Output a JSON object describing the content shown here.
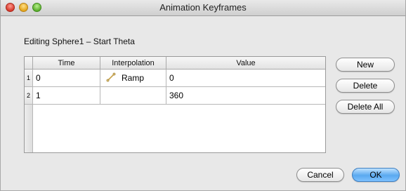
{
  "window": {
    "title": "Animation Keyframes"
  },
  "editing_label": "Editing Sphere1 – Start Theta",
  "table": {
    "headers": [
      "Time",
      "Interpolation",
      "Value"
    ],
    "rows": [
      {
        "index": "1",
        "time": "0",
        "interpolation": "Ramp",
        "value": "0"
      },
      {
        "index": "2",
        "time": "1",
        "interpolation": "",
        "value": "360"
      }
    ]
  },
  "side_buttons": {
    "new": "New",
    "delete": "Delete",
    "delete_all": "Delete All"
  },
  "footer_buttons": {
    "cancel": "Cancel",
    "ok": "OK"
  },
  "colors": {
    "ok_accent": "#5aa9f0",
    "ramp_icon": "#c8a24a"
  },
  "icons": {
    "interpolation": "ramp-icon"
  }
}
